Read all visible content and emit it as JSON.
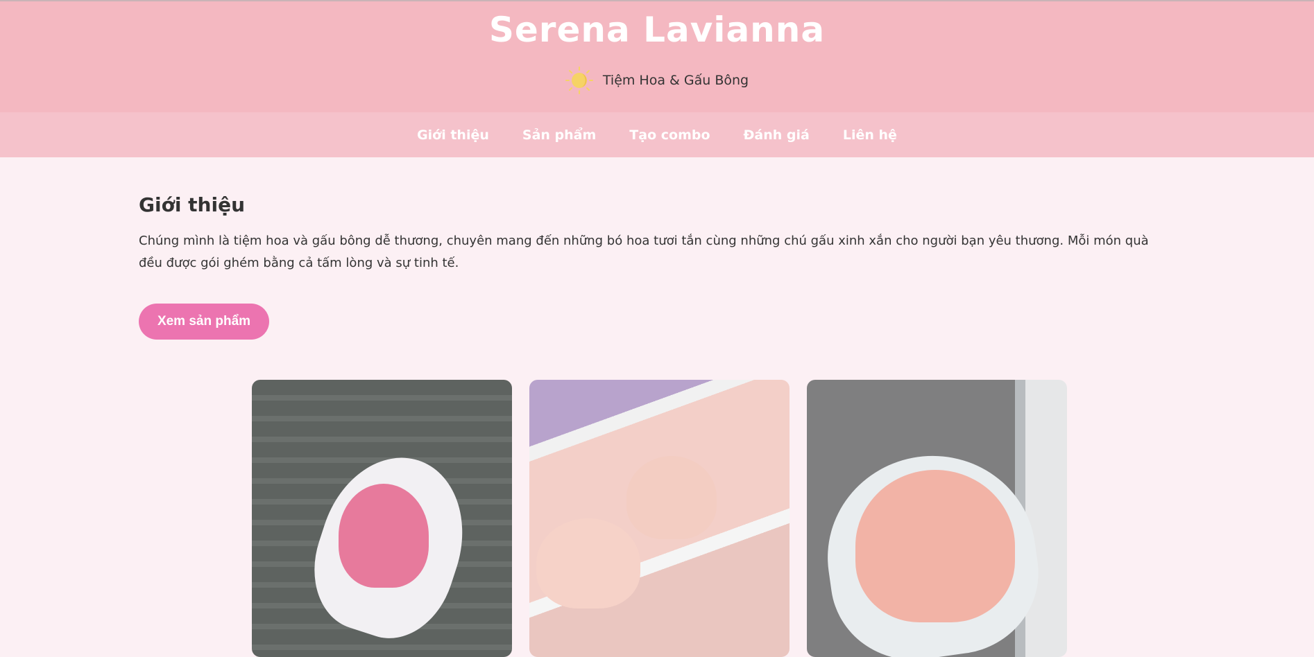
{
  "header": {
    "title": "Serena Lavianna",
    "subtitle": "Tiệm Hoa & Gấu Bông",
    "logo_icon": "sun-icon"
  },
  "nav": {
    "items": [
      {
        "label": "Giới thiệu"
      },
      {
        "label": "Sản phẩm"
      },
      {
        "label": "Tạo combo"
      },
      {
        "label": "Đánh giá"
      },
      {
        "label": "Liên hệ"
      }
    ]
  },
  "about": {
    "heading": "Giới thiệu",
    "text": "Chúng mình là tiệm hoa và gấu bông dễ thương, chuyên mang đến những bó hoa tươi tắn cùng những chú gấu xinh xắn cho người bạn yêu thương. Mỗi món quà đều được gói ghém bằng cả tấm lòng và sự tinh tế.",
    "button": "Xem sản phẩm"
  },
  "colors": {
    "header": "#f4b8c1",
    "nav": "#f5c2cb",
    "background": "#fcf0f4",
    "button": "#ec74b0"
  }
}
